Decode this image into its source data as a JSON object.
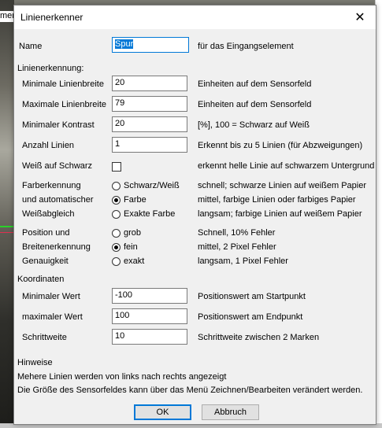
{
  "background": {
    "left_text": "mer"
  },
  "dialog": {
    "title": "Linienerkenner",
    "name": {
      "label": "Name",
      "value": "Spur",
      "hint": "für das Eingangselement"
    },
    "line_section": "Linienerkennung:",
    "fields": [
      {
        "label": "Minimale Linienbreite",
        "value": "20",
        "hint": "Einheiten auf dem Sensorfeld"
      },
      {
        "label": "Maximale Linienbreite",
        "value": "79",
        "hint": "Einheiten auf dem Sensorfeld"
      },
      {
        "label": "Minimaler Kontrast",
        "value": "20",
        "hint": "[%], 100 = Schwarz auf Weiß"
      },
      {
        "label": "Anzahl Linien",
        "value": "1",
        "hint": "Erkennt bis zu 5 Linien (für Abzweigungen)"
      }
    ],
    "white_on_black": {
      "label": "Weiß auf Schwarz",
      "checked": false,
      "hint": "erkennt helle Linie auf schwarzem Untergrund"
    },
    "color_recognition": {
      "label_lines": [
        "Farberkennung",
        "und automatischer",
        "Weißabgleich"
      ],
      "options": [
        {
          "label": "Schwarz/Weiß",
          "selected": false,
          "hint": "schnell; schwarze Linien auf weißem Papier"
        },
        {
          "label": "Farbe",
          "selected": true,
          "hint": "mittel, farbige Linien oder farbiges Papier"
        },
        {
          "label": "Exakte Farbe",
          "selected": false,
          "hint": "langsam; farbige Linien auf weißem Papier"
        }
      ]
    },
    "position": {
      "label_lines": [
        "Position und",
        "Breitenerkennung",
        "Genauigkeit"
      ],
      "options": [
        {
          "label": "grob",
          "selected": false,
          "hint": "Schnell, 10% Fehler"
        },
        {
          "label": "fein",
          "selected": true,
          "hint": "mittel, 2 Pixel Fehler"
        },
        {
          "label": "exakt",
          "selected": false,
          "hint": "langsam, 1 Pixel Fehler"
        }
      ]
    },
    "coord_section": "Koordinaten",
    "coords": [
      {
        "label": "Minimaler Wert",
        "value": "-100",
        "hint": "Positionswert am Startpunkt"
      },
      {
        "label": "maximaler Wert",
        "value": "100",
        "hint": "Positionswert am Endpunkt"
      },
      {
        "label": "Schrittweite",
        "value": "10",
        "hint": "Schrittweite zwischen 2 Marken"
      }
    ],
    "notes": {
      "heading": "Hinweise",
      "line1": "Mehere Linien werden von links nach rechts angezeigt",
      "line2": "Die Größe des Sensorfeldes kann über das Menü Zeichnen/Bearbeiten verändert werden."
    },
    "ok_label": "OK",
    "cancel_label": "Abbruch"
  }
}
